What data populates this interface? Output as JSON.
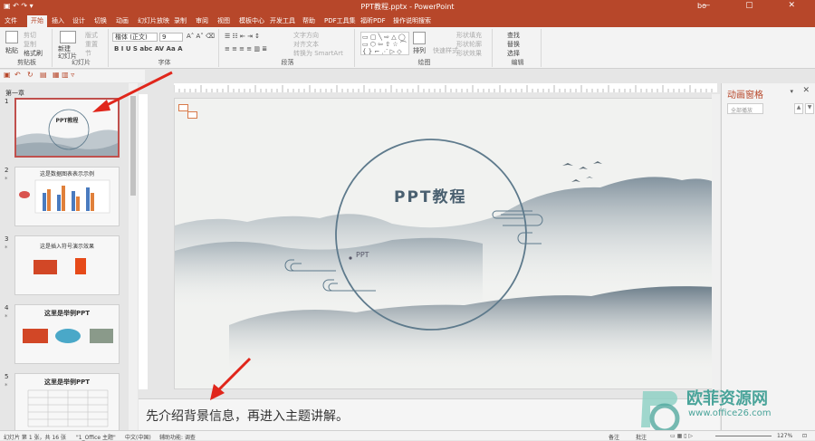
{
  "titlebar": {
    "title": "PPT教程.pptx - PowerPoint",
    "user": "bo"
  },
  "tabs": [
    "文件",
    "开始",
    "插入",
    "设计",
    "切换",
    "动画",
    "幻灯片放映",
    "录制",
    "审阅",
    "视图",
    "模板中心",
    "开发工具",
    "帮助",
    "PDF工具集",
    "福昕PDF",
    "操作说明搜索"
  ],
  "ribbon": {
    "clipboard": {
      "label": "剪贴板",
      "paste": "粘贴",
      "cut": "剪切",
      "copy": "复制",
      "format_painter": "格式刷"
    },
    "slides": {
      "label": "幻灯片",
      "new_slide": "新建\n幻灯片",
      "layout": "版式",
      "reset": "重置",
      "section": "节"
    },
    "font": {
      "label": "字体",
      "font_name": "楷体 (正文)",
      "font_size": "9"
    },
    "paragraph": {
      "label": "段落",
      "text_dir": "文字方向",
      "align_text": "对齐文本",
      "smartart": "转换为 SmartArt"
    },
    "drawing": {
      "label": "绘图",
      "arrange": "排列",
      "quick_styles": "快速样式",
      "fill": "形状填充",
      "outline": "形状轮廓",
      "effects": "形状效果"
    },
    "editing": {
      "label": "编辑",
      "find": "查找",
      "replace": "替换",
      "select": "选择"
    }
  },
  "thumbnails": {
    "section": "第一章",
    "items": [
      {
        "num": "1",
        "title": "PPT教程"
      },
      {
        "num": "2",
        "title": "这是数据图表表示示例"
      },
      {
        "num": "3",
        "title": "这是插入符号演示效果"
      },
      {
        "num": "4",
        "title": "这里是举例PPT"
      },
      {
        "num": "5",
        "title": "这里是举例PPT"
      }
    ]
  },
  "slide": {
    "title": "PPT教程",
    "subtitle": "PPT"
  },
  "notes": "先介绍背景信息，再进入主题讲解。",
  "animation_pane": {
    "title": "动画窗格",
    "play_all": "全部播放"
  },
  "status": {
    "slide_info": "幻灯片 第 1 张，共 16 张",
    "theme": "\"1_Office 主题\"",
    "lang": "中文(中国)",
    "accessibility": "辅助功能: 调查",
    "notes": "备注",
    "comments": "批注",
    "zoom": "127%"
  },
  "watermark": {
    "brand": "欧菲资源网",
    "url": "www.office26.com"
  },
  "colors": {
    "accent": "#b7472a",
    "arrow": "#e0261b",
    "circle": "#5e7a8c"
  }
}
